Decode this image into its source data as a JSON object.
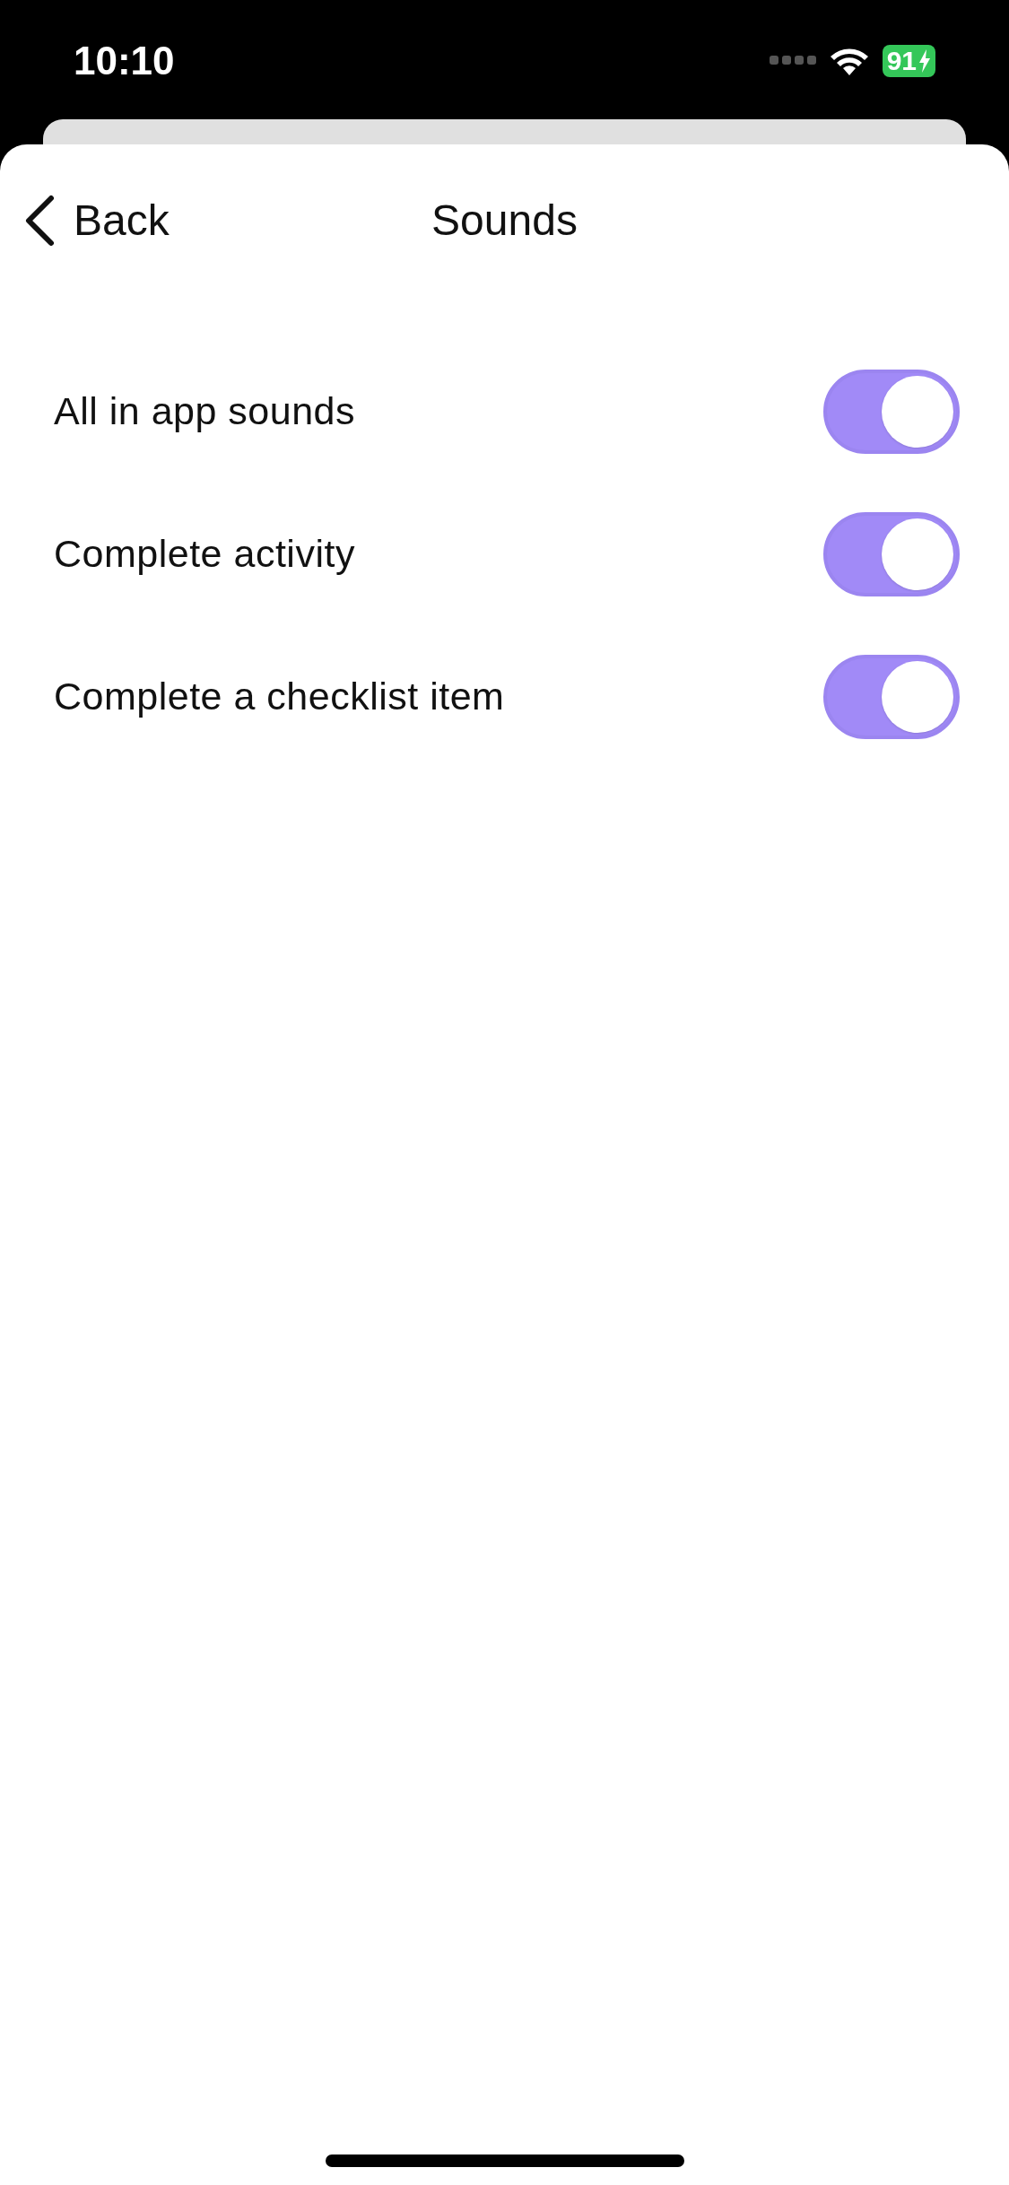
{
  "status_bar": {
    "time": "10:10",
    "battery": "91"
  },
  "nav": {
    "back": "Back",
    "title": "Sounds"
  },
  "settings": [
    {
      "label": "All in app sounds",
      "on": true
    },
    {
      "label": "Complete activity",
      "on": true
    },
    {
      "label": "Complete a checklist item",
      "on": true
    }
  ]
}
